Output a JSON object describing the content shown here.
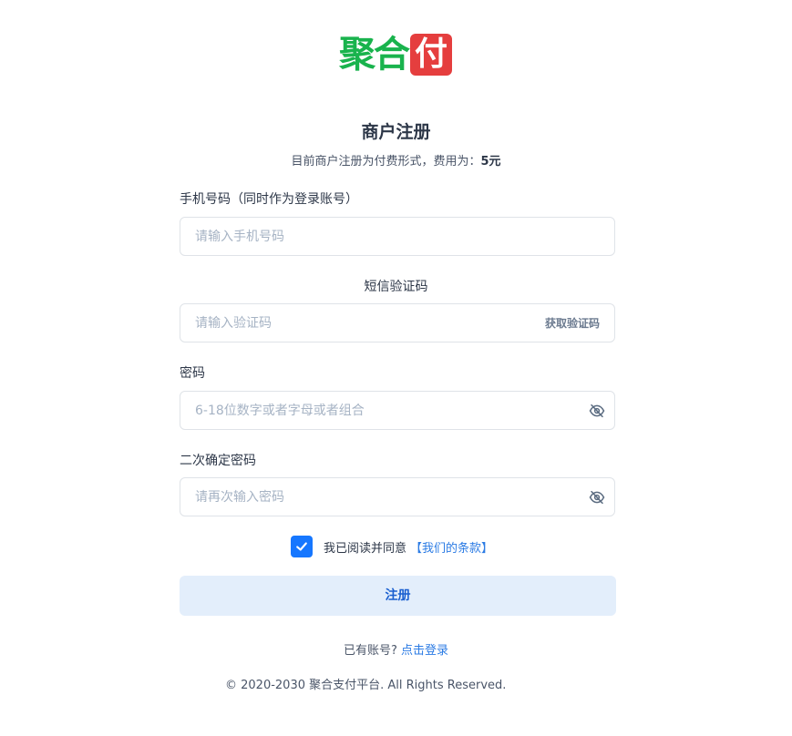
{
  "logo": {
    "text_green": "聚合",
    "text_box": "付",
    "colors": {
      "green": "#19b34d",
      "red": "#e53e3e"
    }
  },
  "header": {
    "title": "商户注册",
    "subtitle_prefix": "目前商户注册为付费形式，费用为：",
    "fee": "5元"
  },
  "form": {
    "phone": {
      "label": "手机号码（同时作为登录账号）",
      "placeholder": "请输入手机号码",
      "value": ""
    },
    "sms": {
      "label": "短信验证码",
      "placeholder": "请输入验证码",
      "button": "获取验证码",
      "value": ""
    },
    "password": {
      "label": "密码",
      "placeholder": "6-18位数字或者字母或者组合",
      "icon": "eye-off-icon",
      "value": ""
    },
    "confirm": {
      "label": "二次确定密码",
      "placeholder": "请再次输入密码",
      "icon": "eye-off-icon",
      "value": ""
    },
    "agreement": {
      "checked": true,
      "text": "我已阅读并同意",
      "link": "【我们的条款】"
    },
    "submit_label": "注册"
  },
  "login": {
    "prompt": "已有账号?",
    "link": "点击登录"
  },
  "footer": {
    "copyright": "© 2020-2030 聚合支付平台. All Rights Reserved."
  },
  "colors": {
    "accent": "#1677ff",
    "link": "#2b7be4",
    "button_bg": "#e3eefb"
  }
}
